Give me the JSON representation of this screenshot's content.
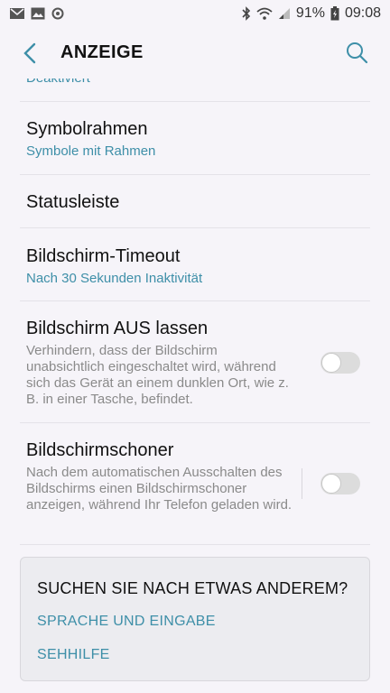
{
  "status_bar": {
    "battery": "91%",
    "time": "09:08"
  },
  "header": {
    "title": "ANZEIGE"
  },
  "partial_item": {
    "sub": "Deaktiviert"
  },
  "items": [
    {
      "title": "Symbolrahmen",
      "sub": "Symbole mit Rahmen"
    },
    {
      "title": "Statusleiste"
    },
    {
      "title": "Bildschirm-Timeout",
      "sub": "Nach 30 Sekunden Inaktivität"
    },
    {
      "title": "Bildschirm AUS lassen",
      "desc": "Verhindern, dass der Bildschirm unabsichtlich eingeschaltet wird, während sich das Gerät an einem dunklen Ort, wie z. B. in einer Tasche, befindet.",
      "toggle": "off"
    },
    {
      "title": "Bildschirmschoner",
      "desc": "Nach dem automatischen Ausschalten des Bildschirms einen Bildschirmschoner anzeigen, während Ihr Telefon geladen wird.",
      "toggle": "off"
    }
  ],
  "suggestion_card": {
    "title": "SUCHEN SIE NACH ETWAS ANDEREM?",
    "links": [
      "SPRACHE UND EINGABE",
      "SEHHILFE"
    ]
  },
  "colors": {
    "accent": "#3e8fa8",
    "background": "#f6f4f9"
  }
}
